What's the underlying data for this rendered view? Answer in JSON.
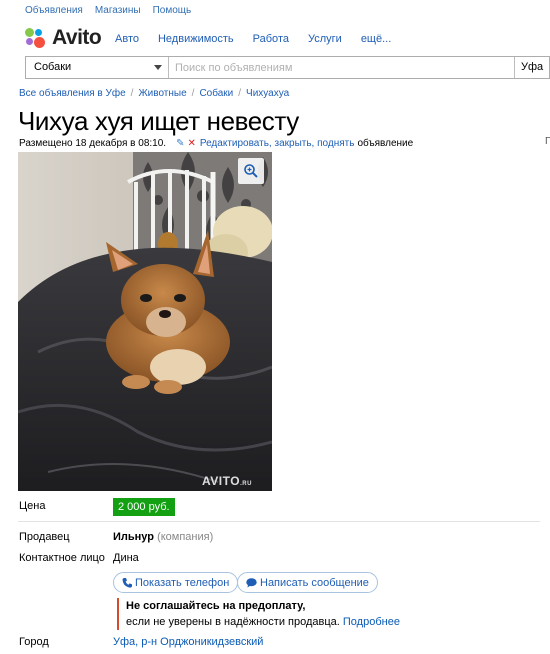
{
  "topbar": {
    "ads": "Объявления",
    "shops": "Магазины",
    "help": "Помощь"
  },
  "header": {
    "logo_text": "Avito",
    "nav": [
      "Авто",
      "Недвижимость",
      "Работа",
      "Услуги",
      "ещё..."
    ]
  },
  "search": {
    "category": "Собаки",
    "placeholder": "Поиск по объявлениям",
    "region": "Уфа"
  },
  "breadcrumb": [
    "Все объявления в Уфе",
    "Животные",
    "Собаки",
    "Чихуахуа"
  ],
  "listing": {
    "title": "Чихуа хуя ищет невесту",
    "posted": "Размещено 18 декабря в 08:10.",
    "edit_link": "Редактировать, закрыть, поднять",
    "edit_suffix": "объявление",
    "watermark": "AVITO",
    "watermark_suffix": ".RU"
  },
  "details": {
    "price_label": "Цена",
    "price_value": "2 000 руб.",
    "seller_label": "Продавец",
    "seller_name": "Ильнур",
    "seller_type": "(компания)",
    "contact_label": "Контактное лицо",
    "contact_name": "Дина",
    "show_phone": "Показать телефон",
    "write_message": "Написать сообщение",
    "warning_title": "Не соглашайтесь на предоплату,",
    "warning_text": "если не уверены в надёжности продавца.",
    "warning_more": "Подробнее",
    "city_label": "Город",
    "city_value": "Уфа, р-н Орджоникидзевский"
  },
  "colors": {
    "price_badge": "#13a113",
    "link": "#1f5eb5",
    "warning_border": "#d24c2d"
  },
  "icons": [
    "zoom-icon",
    "phone-icon",
    "message-icon",
    "pencil-icon",
    "close-icon",
    "avito-logo-dots"
  ]
}
